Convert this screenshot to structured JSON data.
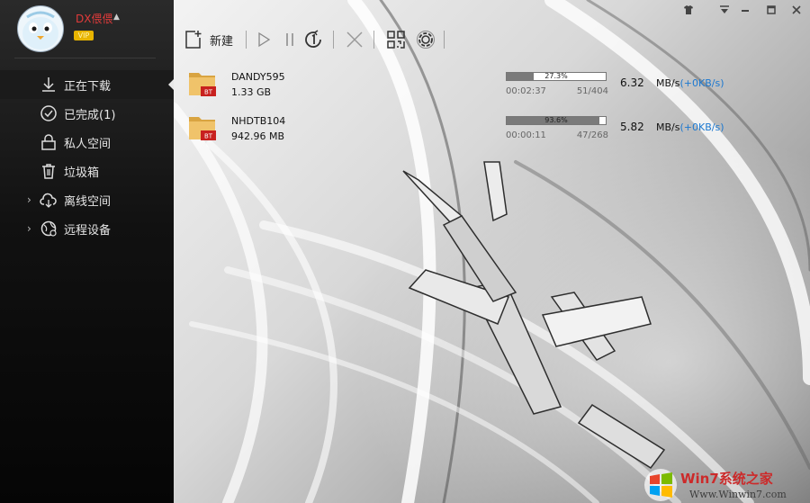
{
  "user": {
    "name": "DX偎偎",
    "vip_badge": "VIP"
  },
  "sidebar": {
    "items": [
      {
        "label": "正在下载",
        "icon": "download-icon",
        "active": true
      },
      {
        "label": "已完成(1)",
        "icon": "check-circle-icon"
      },
      {
        "label": "私人空间",
        "icon": "lock-icon"
      },
      {
        "label": "垃圾箱",
        "icon": "trash-icon"
      },
      {
        "label": "离线空间",
        "icon": "cloud-download-icon",
        "expandable": true
      },
      {
        "label": "远程设备",
        "icon": "remote-device-icon",
        "expandable": true
      }
    ]
  },
  "toolbar": {
    "new_label": "新建",
    "buttons": [
      "new-task",
      "start",
      "pause",
      "limit-speed",
      "delete",
      "qr-code",
      "settings"
    ]
  },
  "window": {
    "controls": [
      "skin",
      "menu",
      "minimize",
      "maximize",
      "close"
    ]
  },
  "downloads": [
    {
      "name": "DANDY595",
      "size": "1.33 GB",
      "type_badge": "BT",
      "progress_text": "27.3%",
      "progress": 0.273,
      "elapsed": "00:02:37",
      "pieces": "51/404",
      "speed": "6.32",
      "speed_unit": "MB/s",
      "upload": "(+0KB/s)"
    },
    {
      "name": "NHDTB104",
      "size": "942.96 MB",
      "type_badge": "BT",
      "progress_text": "93.6%",
      "progress": 0.936,
      "elapsed": "00:00:11",
      "pieces": "47/268",
      "speed": "5.82",
      "speed_unit": "MB/s",
      "upload": "(+0KB/s)"
    }
  ],
  "watermark": {
    "line1": "Win7系统之家",
    "line2": "Www.Winwin7.com"
  },
  "colors": {
    "accent_blue": "#1b78d0",
    "username_red": "#e23b3b",
    "vip_gold": "#e8b400"
  }
}
